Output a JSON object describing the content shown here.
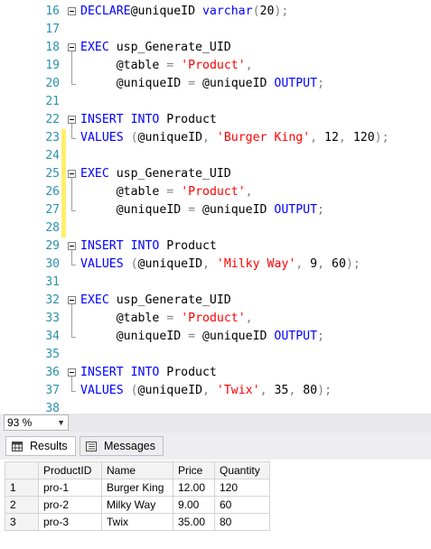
{
  "editor": {
    "lines": [
      {
        "n": "16",
        "tokens": [
          [
            "kw",
            "DECLARE"
          ],
          [
            "",
            "@uniqueID "
          ],
          [
            "kw",
            "varchar"
          ],
          [
            "gr",
            "("
          ],
          [
            "",
            "20"
          ],
          [
            "gr",
            ");"
          ]
        ]
      },
      {
        "n": "17",
        "tokens": []
      },
      {
        "n": "18",
        "tokens": [
          [
            "kw",
            "EXEC"
          ],
          [
            "",
            " usp_Generate_UID"
          ]
        ]
      },
      {
        "n": "19",
        "tokens": [
          [
            "",
            "     @table "
          ],
          [
            "gr",
            "="
          ],
          [
            "",
            " "
          ],
          [
            "str",
            "'Product'"
          ],
          [
            "gr",
            ","
          ]
        ]
      },
      {
        "n": "20",
        "tokens": [
          [
            "",
            "     @uniqueID "
          ],
          [
            "gr",
            "="
          ],
          [
            "",
            " @uniqueID "
          ],
          [
            "kw",
            "OUTPUT"
          ],
          [
            "gr",
            ";"
          ]
        ]
      },
      {
        "n": "21",
        "tokens": []
      },
      {
        "n": "22",
        "tokens": [
          [
            "kw",
            "INSERT"
          ],
          [
            "",
            " "
          ],
          [
            "kw",
            "INTO"
          ],
          [
            "",
            " Product"
          ]
        ]
      },
      {
        "n": "23",
        "tokens": [
          [
            "kw",
            "VALUES"
          ],
          [
            "",
            " "
          ],
          [
            "gr",
            "("
          ],
          [
            "",
            "@uniqueID"
          ],
          [
            "gr",
            ","
          ],
          [
            "",
            " "
          ],
          [
            "str",
            "'Burger King'"
          ],
          [
            "gr",
            ","
          ],
          [
            "",
            " 12"
          ],
          [
            "gr",
            ","
          ],
          [
            "",
            " 120"
          ],
          [
            "gr",
            ");"
          ]
        ]
      },
      {
        "n": "24",
        "tokens": []
      },
      {
        "n": "25",
        "tokens": [
          [
            "kw",
            "EXEC"
          ],
          [
            "",
            " usp_Generate_UID"
          ]
        ]
      },
      {
        "n": "26",
        "tokens": [
          [
            "",
            "     @table "
          ],
          [
            "gr",
            "="
          ],
          [
            "",
            " "
          ],
          [
            "str",
            "'Product'"
          ],
          [
            "gr",
            ","
          ]
        ]
      },
      {
        "n": "27",
        "tokens": [
          [
            "",
            "     @uniqueID "
          ],
          [
            "gr",
            "="
          ],
          [
            "",
            " @uniqueID "
          ],
          [
            "kw",
            "OUTPUT"
          ],
          [
            "gr",
            ";"
          ]
        ]
      },
      {
        "n": "28",
        "tokens": []
      },
      {
        "n": "29",
        "tokens": [
          [
            "kw",
            "INSERT"
          ],
          [
            "",
            " "
          ],
          [
            "kw",
            "INTO"
          ],
          [
            "",
            " Product"
          ]
        ]
      },
      {
        "n": "30",
        "tokens": [
          [
            "kw",
            "VALUES"
          ],
          [
            "",
            " "
          ],
          [
            "gr",
            "("
          ],
          [
            "",
            "@uniqueID"
          ],
          [
            "gr",
            ","
          ],
          [
            "",
            " "
          ],
          [
            "str",
            "'Milky Way'"
          ],
          [
            "gr",
            ","
          ],
          [
            "",
            " 9"
          ],
          [
            "gr",
            ","
          ],
          [
            "",
            " 60"
          ],
          [
            "gr",
            ");"
          ]
        ]
      },
      {
        "n": "31",
        "tokens": []
      },
      {
        "n": "32",
        "tokens": [
          [
            "kw",
            "EXEC"
          ],
          [
            "",
            " usp_Generate_UID"
          ]
        ]
      },
      {
        "n": "33",
        "tokens": [
          [
            "",
            "     @table "
          ],
          [
            "gr",
            "="
          ],
          [
            "",
            " "
          ],
          [
            "str",
            "'Product'"
          ],
          [
            "gr",
            ","
          ]
        ]
      },
      {
        "n": "34",
        "tokens": [
          [
            "",
            "     @uniqueID "
          ],
          [
            "gr",
            "="
          ],
          [
            "",
            " @uniqueID "
          ],
          [
            "kw",
            "OUTPUT"
          ],
          [
            "gr",
            ";"
          ]
        ]
      },
      {
        "n": "35",
        "tokens": []
      },
      {
        "n": "36",
        "tokens": [
          [
            "kw",
            "INSERT"
          ],
          [
            "",
            " "
          ],
          [
            "kw",
            "INTO"
          ],
          [
            "",
            " Product"
          ]
        ]
      },
      {
        "n": "37",
        "tokens": [
          [
            "kw",
            "VALUES"
          ],
          [
            "",
            " "
          ],
          [
            "gr",
            "("
          ],
          [
            "",
            "@uniqueID"
          ],
          [
            "gr",
            ","
          ],
          [
            "",
            " "
          ],
          [
            "str",
            "'Twix'"
          ],
          [
            "gr",
            ","
          ],
          [
            "",
            " 35"
          ],
          [
            "gr",
            ","
          ],
          [
            "",
            " 80"
          ],
          [
            "gr",
            ");"
          ]
        ]
      },
      {
        "n": "38",
        "tokens": []
      }
    ]
  },
  "zoom": {
    "value": "93 %",
    "arrow": "▼"
  },
  "tabs": {
    "results": "Results",
    "messages": "Messages"
  },
  "results": {
    "columns": [
      "",
      "ProductID",
      "Name",
      "Price",
      "Quantity"
    ],
    "rows": [
      [
        "1",
        "pro-1",
        "Burger King",
        "12.00",
        "120"
      ],
      [
        "2",
        "pro-2",
        "Milky Way",
        "9.00",
        "60"
      ],
      [
        "3",
        "pro-3",
        "Twix",
        "35.00",
        "80"
      ]
    ]
  },
  "colors": {
    "keyword": "#0000ff",
    "string": "#ff0000",
    "punct": "#808080",
    "line_number": "#2b91af",
    "change_marker": "#ffef6b"
  }
}
